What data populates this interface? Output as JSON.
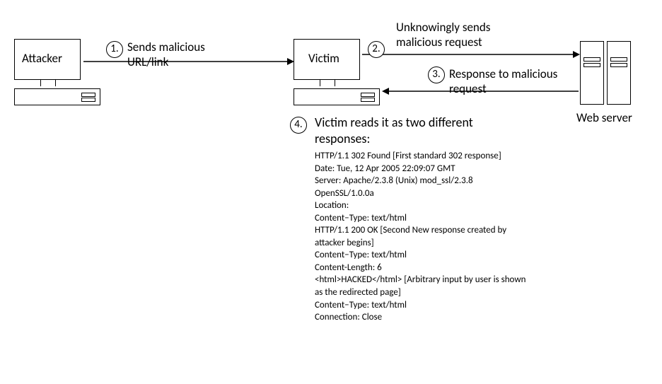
{
  "nodes": {
    "attacker": "Attacker",
    "victim": "Victim",
    "webserver": "Web server"
  },
  "steps": {
    "s1": {
      "num": "1.",
      "text": "Sends malicious URL/link"
    },
    "s2": {
      "num": "2.",
      "text": "Unknowingly sends malicious request"
    },
    "s3": {
      "num": "3.",
      "text": "Response to malicious request"
    },
    "s4": {
      "num": "4.",
      "heading": "Victim reads it as two different responses:",
      "lines": [
        "HTTP/1.1 302  Found [First standard 302 response]",
        "Date: Tue, 12  Apr 2005  22:09:07  GMT",
        "Server: Apache/2.3.8 (Unix) mod_ssl/2.3.8 OpenSSL/1.0.0a",
        "Location:",
        "Content−Type: text/html",
        "HTTP/1.1 200  OK [Second New response created by attacker begins]",
        "Content−Type: text/html",
        "Content-Length: 6",
        "<html>HACKED</html> [Arbitrary input by user is shown as the redirected page]",
        "Content−Type: text/html",
        "Connection: Close"
      ]
    }
  }
}
